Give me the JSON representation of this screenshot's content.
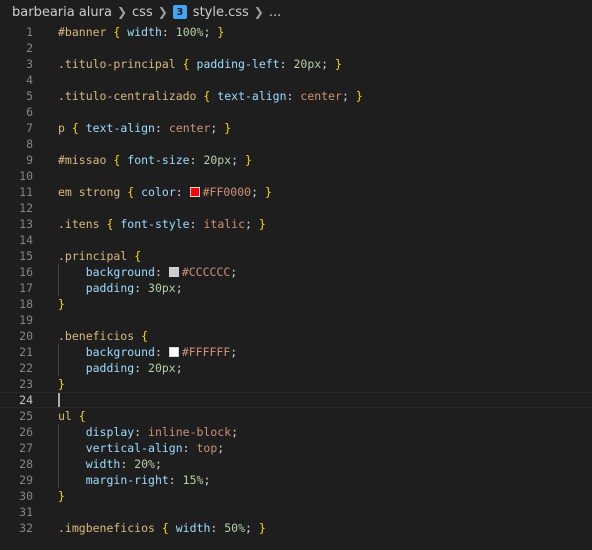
{
  "breadcrumb": {
    "items": [
      "barbearia alura",
      "css",
      "style.css",
      "..."
    ],
    "file_icon": "css3-icon",
    "separator_icon": "chevron-right-icon"
  },
  "editor": {
    "current_line": 24,
    "colors": {
      "background": "#1e1e1e",
      "selector": "#d7ba7d",
      "property": "#9cdcfe",
      "number": "#b5cea8",
      "value": "#ce9178",
      "brace": "#ffd700",
      "line_number": "#858585"
    },
    "lines": [
      {
        "n": 1,
        "tokens": [
          {
            "t": "#banner",
            "c": "sel"
          },
          {
            "t": " ",
            "c": "punc"
          },
          {
            "t": "{",
            "c": "brace"
          },
          {
            "t": " ",
            "c": "punc"
          },
          {
            "t": "width",
            "c": "prop"
          },
          {
            "t": ": ",
            "c": "punc"
          },
          {
            "t": "100%",
            "c": "num"
          },
          {
            "t": "; ",
            "c": "punc"
          },
          {
            "t": "}",
            "c": "brace"
          }
        ]
      },
      {
        "n": 2,
        "tokens": []
      },
      {
        "n": 3,
        "tokens": [
          {
            "t": ".titulo-principal",
            "c": "sel"
          },
          {
            "t": " ",
            "c": "punc"
          },
          {
            "t": "{",
            "c": "brace"
          },
          {
            "t": " ",
            "c": "punc"
          },
          {
            "t": "padding-left",
            "c": "prop"
          },
          {
            "t": ": ",
            "c": "punc"
          },
          {
            "t": "20px",
            "c": "num"
          },
          {
            "t": "; ",
            "c": "punc"
          },
          {
            "t": "}",
            "c": "brace"
          }
        ]
      },
      {
        "n": 4,
        "tokens": []
      },
      {
        "n": 5,
        "tokens": [
          {
            "t": ".titulo-centralizado",
            "c": "sel"
          },
          {
            "t": " ",
            "c": "punc"
          },
          {
            "t": "{",
            "c": "brace"
          },
          {
            "t": " ",
            "c": "punc"
          },
          {
            "t": "text-align",
            "c": "prop"
          },
          {
            "t": ": ",
            "c": "punc"
          },
          {
            "t": "center",
            "c": "val"
          },
          {
            "t": "; ",
            "c": "punc"
          },
          {
            "t": "}",
            "c": "brace"
          }
        ]
      },
      {
        "n": 6,
        "tokens": []
      },
      {
        "n": 7,
        "tokens": [
          {
            "t": "p",
            "c": "tag"
          },
          {
            "t": " ",
            "c": "punc"
          },
          {
            "t": "{",
            "c": "brace"
          },
          {
            "t": " ",
            "c": "punc"
          },
          {
            "t": "text-align",
            "c": "prop"
          },
          {
            "t": ": ",
            "c": "punc"
          },
          {
            "t": "center",
            "c": "val"
          },
          {
            "t": "; ",
            "c": "punc"
          },
          {
            "t": "}",
            "c": "brace"
          }
        ]
      },
      {
        "n": 8,
        "tokens": []
      },
      {
        "n": 9,
        "tokens": [
          {
            "t": "#missao",
            "c": "sel"
          },
          {
            "t": " ",
            "c": "punc"
          },
          {
            "t": "{",
            "c": "brace"
          },
          {
            "t": " ",
            "c": "punc"
          },
          {
            "t": "font-size",
            "c": "prop"
          },
          {
            "t": ": ",
            "c": "punc"
          },
          {
            "t": "20px",
            "c": "num"
          },
          {
            "t": "; ",
            "c": "punc"
          },
          {
            "t": "}",
            "c": "brace"
          }
        ]
      },
      {
        "n": 10,
        "tokens": []
      },
      {
        "n": 11,
        "tokens": [
          {
            "t": "em strong",
            "c": "tag"
          },
          {
            "t": " ",
            "c": "punc"
          },
          {
            "t": "{",
            "c": "brace"
          },
          {
            "t": " ",
            "c": "punc"
          },
          {
            "t": "color",
            "c": "prop"
          },
          {
            "t": ": ",
            "c": "punc"
          },
          {
            "sw": "#FF0000"
          },
          {
            "t": "#FF0000",
            "c": "val"
          },
          {
            "t": "; ",
            "c": "punc"
          },
          {
            "t": "}",
            "c": "brace"
          }
        ]
      },
      {
        "n": 12,
        "tokens": []
      },
      {
        "n": 13,
        "tokens": [
          {
            "t": ".itens",
            "c": "sel"
          },
          {
            "t": " ",
            "c": "punc"
          },
          {
            "t": "{",
            "c": "brace"
          },
          {
            "t": " ",
            "c": "punc"
          },
          {
            "t": "font-style",
            "c": "prop"
          },
          {
            "t": ": ",
            "c": "punc"
          },
          {
            "t": "italic",
            "c": "val"
          },
          {
            "t": "; ",
            "c": "punc"
          },
          {
            "t": "}",
            "c": "brace"
          }
        ]
      },
      {
        "n": 14,
        "tokens": []
      },
      {
        "n": 15,
        "tokens": [
          {
            "t": ".principal",
            "c": "sel"
          },
          {
            "t": " ",
            "c": "punc"
          },
          {
            "t": "{",
            "c": "brace"
          }
        ]
      },
      {
        "n": 16,
        "tokens": [
          {
            "t": "    ",
            "c": "punc"
          },
          {
            "t": "background",
            "c": "prop"
          },
          {
            "t": ": ",
            "c": "punc"
          },
          {
            "sw": "#CCCCCC"
          },
          {
            "t": "#CCCCCC",
            "c": "val"
          },
          {
            "t": ";",
            "c": "punc"
          }
        ]
      },
      {
        "n": 17,
        "tokens": [
          {
            "t": "    ",
            "c": "punc"
          },
          {
            "t": "padding",
            "c": "prop"
          },
          {
            "t": ": ",
            "c": "punc"
          },
          {
            "t": "30px",
            "c": "num"
          },
          {
            "t": ";",
            "c": "punc"
          }
        ]
      },
      {
        "n": 18,
        "tokens": [
          {
            "t": "}",
            "c": "brace"
          }
        ]
      },
      {
        "n": 19,
        "tokens": []
      },
      {
        "n": 20,
        "tokens": [
          {
            "t": ".beneficios",
            "c": "sel"
          },
          {
            "t": " ",
            "c": "punc"
          },
          {
            "t": "{",
            "c": "brace"
          }
        ]
      },
      {
        "n": 21,
        "tokens": [
          {
            "t": "    ",
            "c": "punc"
          },
          {
            "t": "background",
            "c": "prop"
          },
          {
            "t": ": ",
            "c": "punc"
          },
          {
            "sw": "#FFFFFF"
          },
          {
            "t": "#FFFFFF",
            "c": "val"
          },
          {
            "t": ";",
            "c": "punc"
          }
        ]
      },
      {
        "n": 22,
        "tokens": [
          {
            "t": "    ",
            "c": "punc"
          },
          {
            "t": "padding",
            "c": "prop"
          },
          {
            "t": ": ",
            "c": "punc"
          },
          {
            "t": "20px",
            "c": "num"
          },
          {
            "t": ";",
            "c": "punc"
          }
        ]
      },
      {
        "n": 23,
        "tokens": [
          {
            "t": "}",
            "c": "brace"
          }
        ]
      },
      {
        "n": 24,
        "tokens": []
      },
      {
        "n": 25,
        "tokens": [
          {
            "t": "ul",
            "c": "tag"
          },
          {
            "t": " ",
            "c": "punc"
          },
          {
            "t": "{",
            "c": "brace"
          }
        ]
      },
      {
        "n": 26,
        "tokens": [
          {
            "t": "    ",
            "c": "punc"
          },
          {
            "t": "display",
            "c": "prop"
          },
          {
            "t": ": ",
            "c": "punc"
          },
          {
            "t": "inline-block",
            "c": "val"
          },
          {
            "t": ";",
            "c": "punc"
          }
        ]
      },
      {
        "n": 27,
        "tokens": [
          {
            "t": "    ",
            "c": "punc"
          },
          {
            "t": "vertical-align",
            "c": "prop"
          },
          {
            "t": ": ",
            "c": "punc"
          },
          {
            "t": "top",
            "c": "val"
          },
          {
            "t": ";",
            "c": "punc"
          }
        ]
      },
      {
        "n": 28,
        "tokens": [
          {
            "t": "    ",
            "c": "punc"
          },
          {
            "t": "width",
            "c": "prop"
          },
          {
            "t": ": ",
            "c": "punc"
          },
          {
            "t": "20%",
            "c": "num"
          },
          {
            "t": ";",
            "c": "punc"
          }
        ]
      },
      {
        "n": 29,
        "tokens": [
          {
            "t": "    ",
            "c": "punc"
          },
          {
            "t": "margin-right",
            "c": "prop"
          },
          {
            "t": ": ",
            "c": "punc"
          },
          {
            "t": "15%",
            "c": "num"
          },
          {
            "t": ";",
            "c": "punc"
          }
        ]
      },
      {
        "n": 30,
        "tokens": [
          {
            "t": "}",
            "c": "brace"
          }
        ]
      },
      {
        "n": 31,
        "tokens": []
      },
      {
        "n": 32,
        "tokens": [
          {
            "t": ".imgbeneficios",
            "c": "sel"
          },
          {
            "t": " ",
            "c": "punc"
          },
          {
            "t": "{",
            "c": "brace"
          },
          {
            "t": " ",
            "c": "punc"
          },
          {
            "t": "width",
            "c": "prop"
          },
          {
            "t": ": ",
            "c": "punc"
          },
          {
            "t": "50%",
            "c": "num"
          },
          {
            "t": "; ",
            "c": "punc"
          },
          {
            "t": "}",
            "c": "brace"
          }
        ]
      }
    ]
  }
}
